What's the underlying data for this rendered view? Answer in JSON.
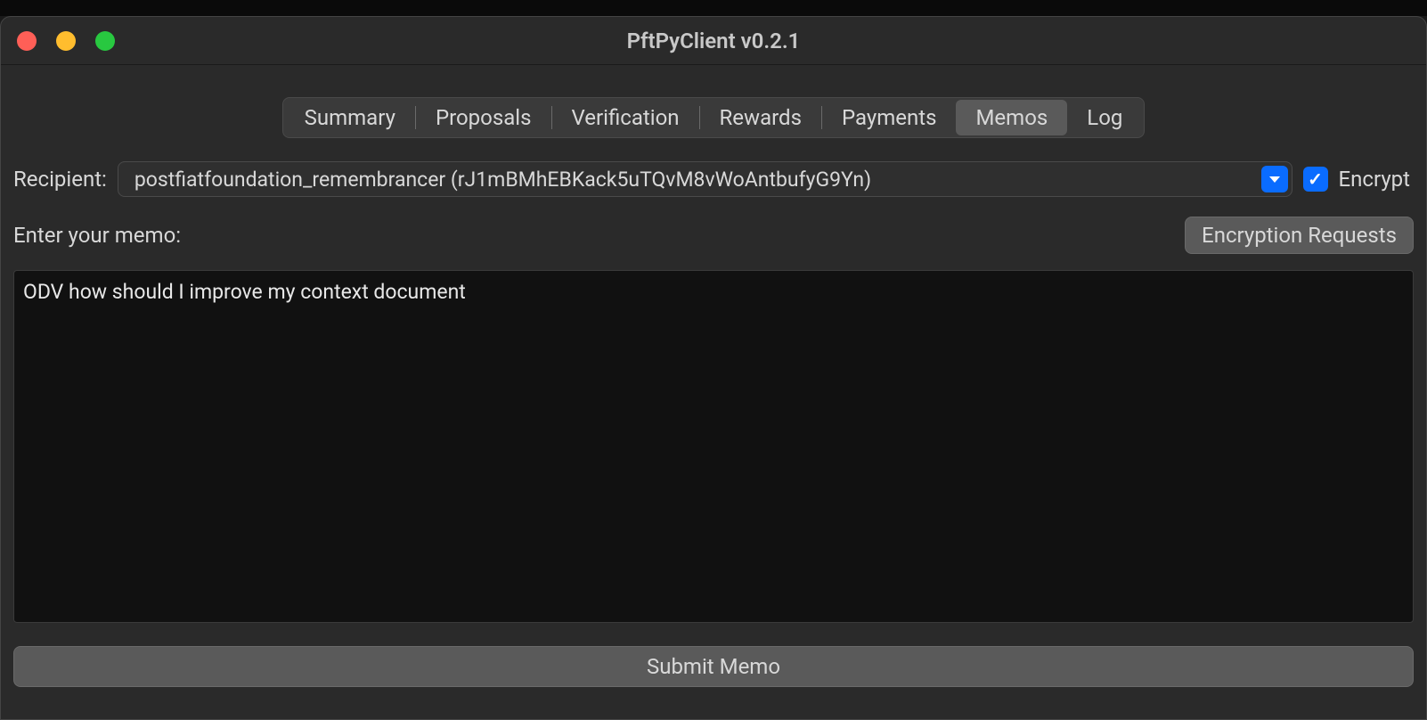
{
  "window": {
    "title": "PftPyClient v0.2.1"
  },
  "tabs": {
    "items": [
      {
        "label": "Summary"
      },
      {
        "label": "Proposals"
      },
      {
        "label": "Verification"
      },
      {
        "label": "Rewards"
      },
      {
        "label": "Payments"
      },
      {
        "label": "Memos"
      },
      {
        "label": "Log"
      }
    ],
    "active_index": 5
  },
  "recipient": {
    "label": "Recipient:",
    "value": "postfiatfoundation_remembrancer (rJ1mBMhEBKack5uTQvM8vWoAntbufyG9Yn)"
  },
  "encrypt": {
    "label": "Encrypt",
    "checked": true
  },
  "memo": {
    "label": "Enter your memo:",
    "encryption_requests_label": "Encryption Requests",
    "text": "ODV how should I improve my context document"
  },
  "submit": {
    "label": "Submit Memo"
  }
}
